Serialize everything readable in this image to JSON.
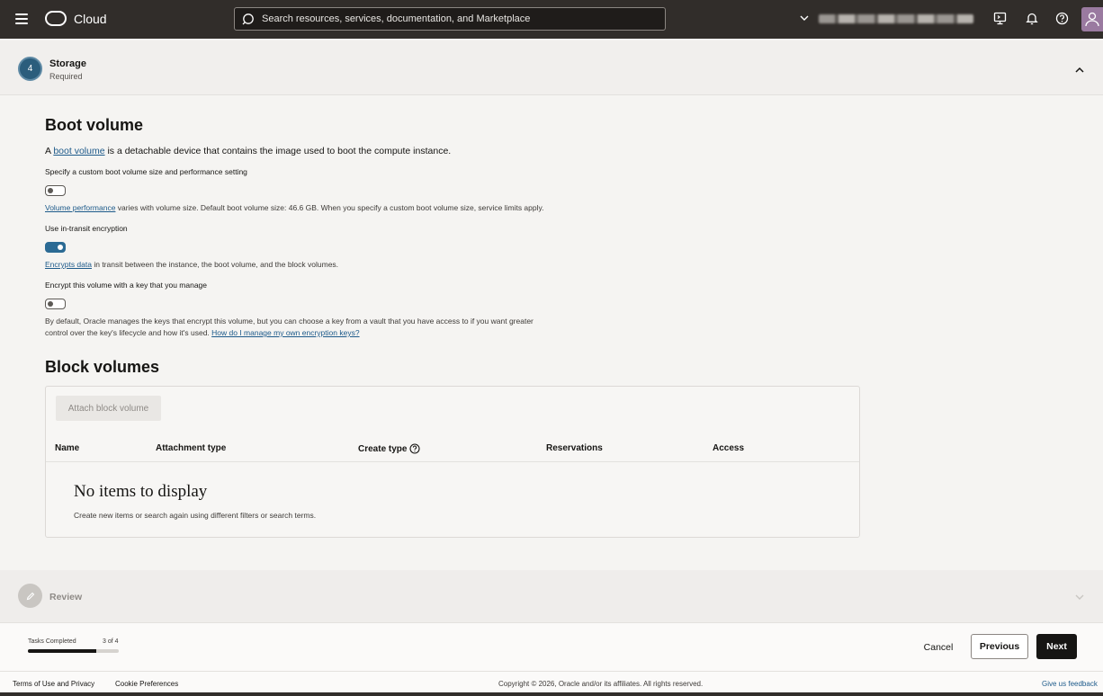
{
  "header": {
    "brand": "Cloud",
    "search_placeholder": "Search resources, services, documentation, and Marketplace",
    "icons": [
      "menu-icon",
      "cloud-logo",
      "search-icon",
      "chevron-down-icon",
      "cloud-shell-icon",
      "bell-icon",
      "help-icon",
      "avatar"
    ]
  },
  "storage_section": {
    "step_number": "4",
    "title": "Storage",
    "subtitle": "Required"
  },
  "boot_volume": {
    "heading": "Boot volume",
    "intro_prefix": "A ",
    "intro_link": "boot volume",
    "intro_suffix": " is a detachable device that contains the image used to boot the compute instance.",
    "custom_size_label": "Specify a custom boot volume size and performance setting",
    "custom_size_enabled": false,
    "perf_link": "Volume performance",
    "perf_text": " varies with volume size. Default boot volume size: 46.6 GB. When you specify a custom boot volume size, service limits apply.",
    "transit_label": "Use in-transit encryption",
    "transit_enabled": true,
    "transit_link": "Encrypts data",
    "transit_text": " in transit between the instance, the boot volume, and the block volumes.",
    "own_key_label": "Encrypt this volume with a key that you manage",
    "own_key_enabled": false,
    "own_key_text_1": "By default, Oracle manages the keys that encrypt this volume, but you can choose a key from a vault that you have access to if you want greater",
    "own_key_text_2": "control over the key's lifecycle and how it's used. ",
    "own_key_link": "How do I manage my own encryption keys?"
  },
  "block_volumes": {
    "heading": "Block volumes",
    "attach_button": "Attach block volume",
    "columns": [
      "Name",
      "Attachment type",
      "Create type",
      "Reservations",
      "Access"
    ],
    "empty_title": "No items to display",
    "empty_subtitle": "Create new items or search again using different filters or search terms."
  },
  "review_section": {
    "title": "Review"
  },
  "action_bar": {
    "tasks_label": "Tasks Completed",
    "tasks_count": "3 of 4",
    "progress_fraction": 0.75,
    "cancel": "Cancel",
    "previous": "Previous",
    "next": "Next"
  },
  "footer": {
    "terms": "Terms of Use and Privacy",
    "cookies": "Cookie Preferences",
    "copyright": "Copyright © 2026, Oracle and/or its affiliates. All rights reserved.",
    "feedback": "Give us feedback"
  },
  "colors": {
    "header_bg": "#312d2a",
    "accent": "#2b6a94",
    "link": "#1d5a8a",
    "primary_button": "#161513"
  }
}
